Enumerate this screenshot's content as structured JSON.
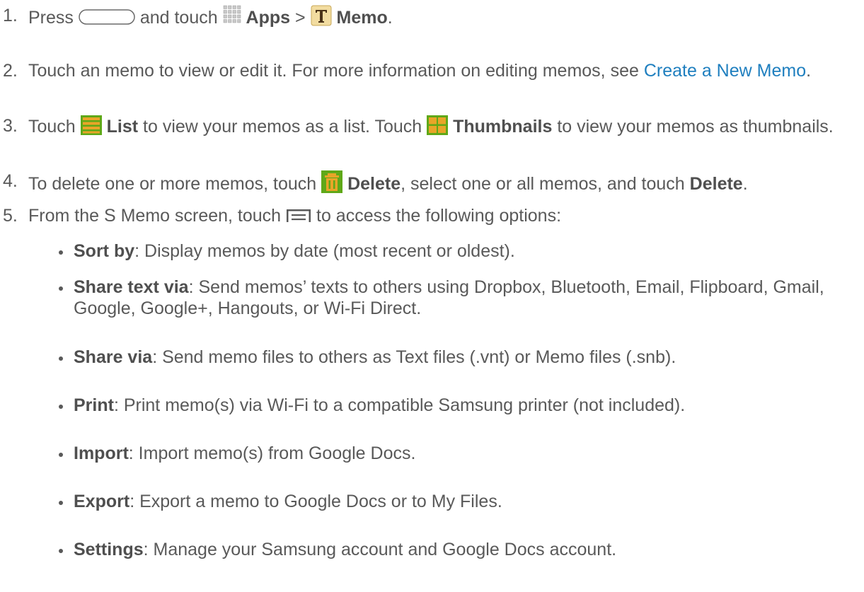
{
  "steps": [
    {
      "number": "1.",
      "press": "Press",
      "and_touch": "and touch",
      "apps": "Apps",
      "sep": ">",
      "memo": "Memo",
      "period": "."
    },
    {
      "number": "2.",
      "text": "Touch an memo to view or edit it. For more information on editing memos, see",
      "link": "Create a New Memo",
      "period": "."
    },
    {
      "number": "3.",
      "touch1": "Touch",
      "list": "List",
      "mid": "to view your memos as a list. Touch",
      "thumbnails": "Thumbnails",
      "end": "to view your memos as thumbnails."
    },
    {
      "number": "4.",
      "pre": "To delete one or more memos, touch",
      "delete_icon_label": "Delete",
      "mid": ", select one or all memos, and touch",
      "delete_label": "Delete",
      "period": "."
    },
    {
      "number": "5.",
      "pre": "From the S Memo screen, touch",
      "post": "to access the following options:"
    }
  ],
  "options": [
    {
      "term": "Sort by",
      "desc": ": Display memos by date (most recent or oldest)."
    },
    {
      "term": "Share text via",
      "desc": ": Send memos’ texts to others using Dropbox, Bluetooth, Email, Flipboard, Gmail, Google, Google+, Hangouts, or Wi-Fi Direct."
    },
    {
      "term": "Share via",
      "desc": ": Send memo files to others as Text files (.vnt) or Memo files (.snb)."
    },
    {
      "term": "Print",
      "desc": ": Print memo(s) via Wi-Fi to a compatible Samsung printer (not included)."
    },
    {
      "term": "Import",
      "desc": ": Import memo(s) from Google Docs."
    },
    {
      "term": "Export",
      "desc": ": Export a memo to Google Docs or to My Files."
    },
    {
      "term": "Settings",
      "desc": ": Manage your Samsung account and Google Docs account."
    }
  ],
  "icons": {
    "home_button": "home-button-icon",
    "apps": "apps-grid-icon",
    "memo": "memo-app-icon",
    "list": "list-view-icon",
    "thumbnails": "thumbnails-view-icon",
    "delete": "trash-icon",
    "menu": "menu-icon"
  },
  "colors": {
    "text": "#595959",
    "link": "#1f7fbf",
    "icon_green": "#5fa818",
    "icon_orange": "#e8a528"
  }
}
